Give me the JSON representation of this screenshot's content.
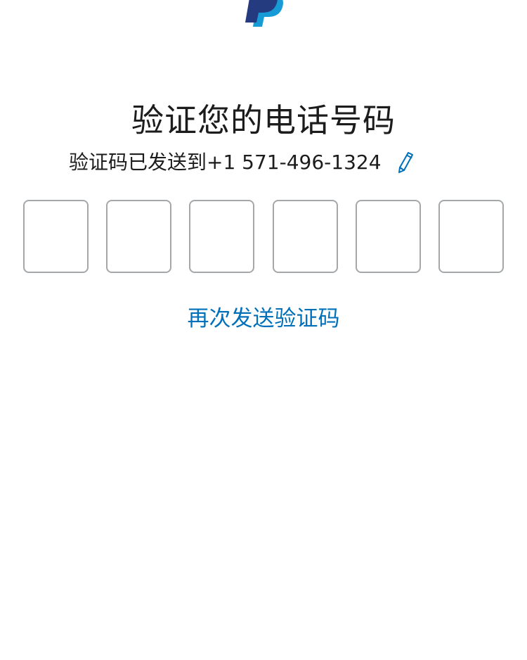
{
  "brand": {
    "logo_icon": "paypal-logo-icon",
    "dark_blue": "#253b80",
    "light_blue": "#179bd7"
  },
  "header": {
    "title": "验证您的电话号码"
  },
  "verification": {
    "sent_message": "验证码已发送到+1 571-496-1324",
    "edit_icon": "pencil-icon",
    "code_length": 6,
    "code_digits": [
      "",
      "",
      "",
      "",
      "",
      ""
    ]
  },
  "actions": {
    "resend_label": "再次发送验证码",
    "link_color": "#0070ba"
  }
}
